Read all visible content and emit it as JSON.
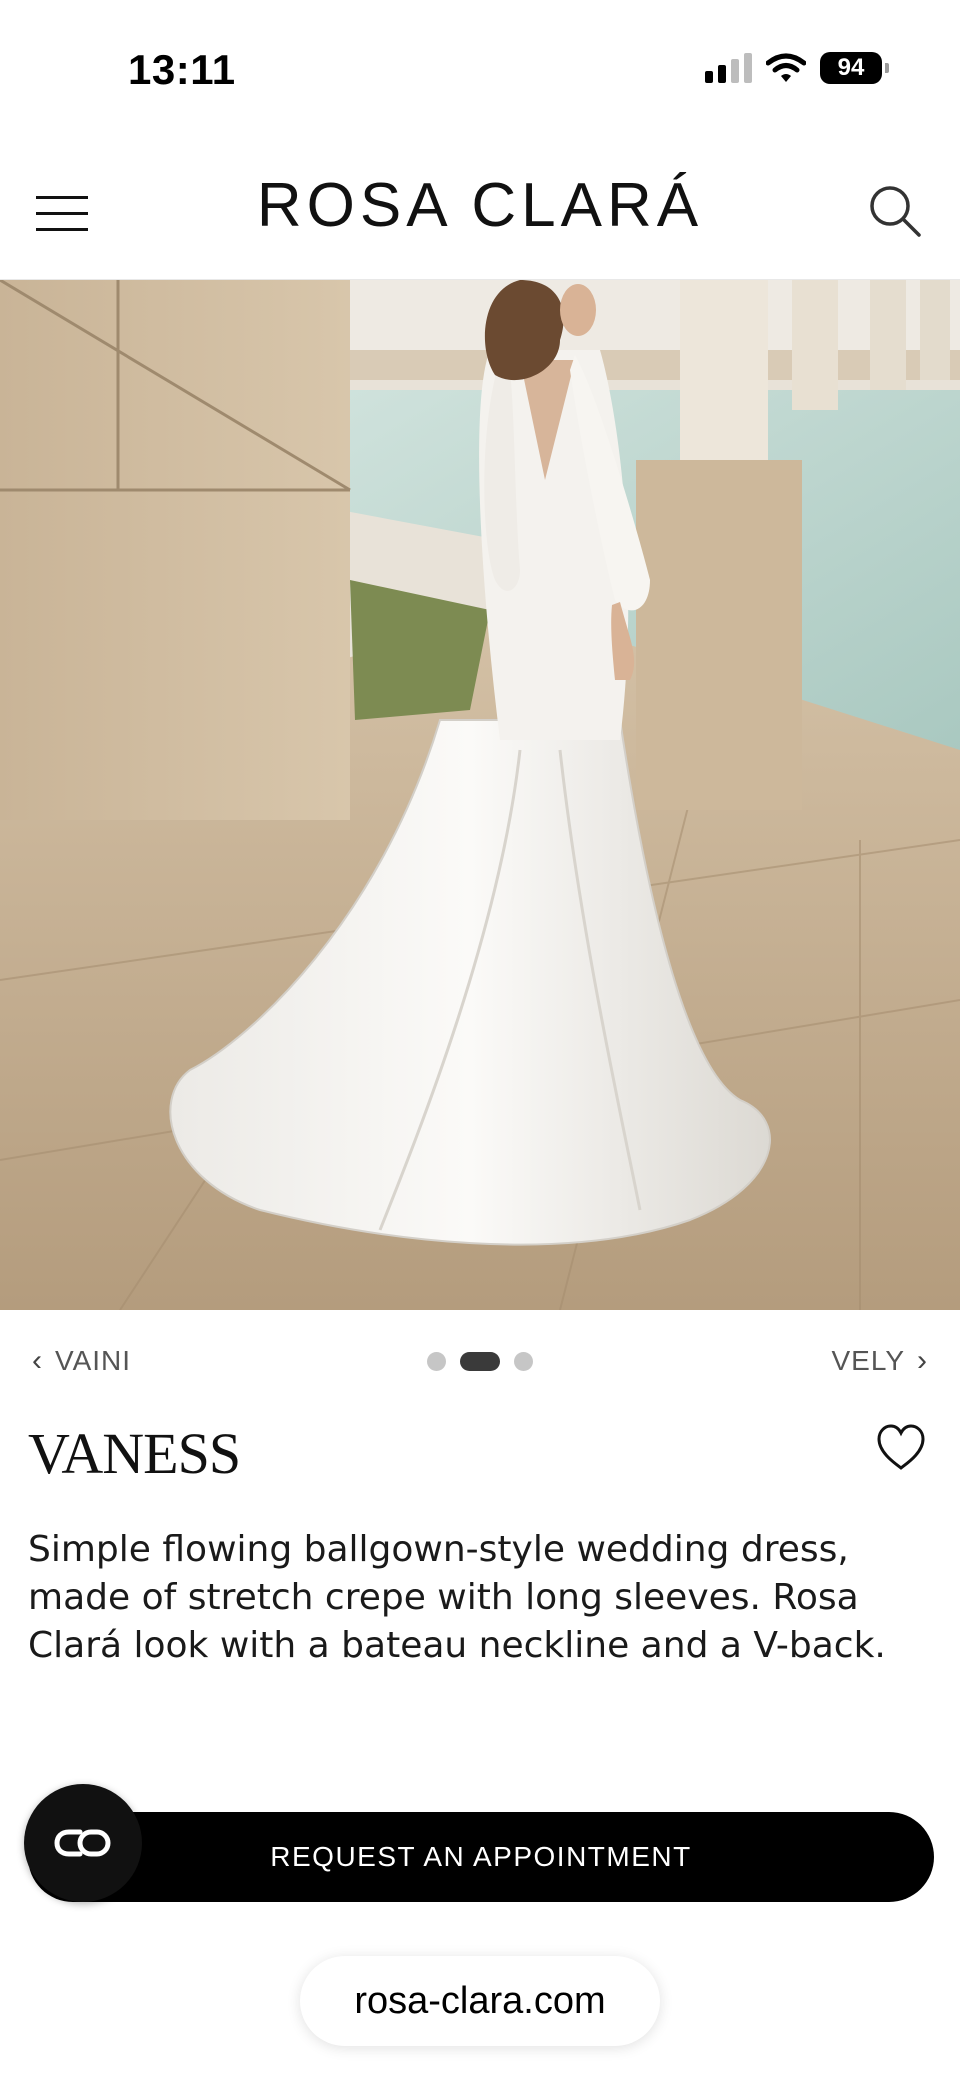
{
  "status_bar": {
    "time": "13:11",
    "battery": "94"
  },
  "header": {
    "brand": "ROSA CLARÁ",
    "menu_icon": "hamburger-icon",
    "search_icon": "search-icon"
  },
  "hero": {
    "image": "wedding-dress-photo"
  },
  "carousel": {
    "prev_label": "VAINI",
    "next_label": "VELY",
    "dot_count": 3,
    "active_index": 1
  },
  "product": {
    "name": "VANESS",
    "description": "Simple flowing ballgown-style wedding dress, made of stretch crepe with long sleeves. Rosa Clará look with a bateau neckline and a V-back.",
    "favorite_icon": "heart-icon"
  },
  "cta": {
    "label": "REQUEST AN APPOINTMENT",
    "chat_icon": "chat-icon"
  },
  "browser": {
    "url": "rosa-clara.com"
  },
  "colors": {
    "cta_bg": "#000000",
    "cta_text": "#ffffff",
    "accent_dark": "#111111"
  }
}
